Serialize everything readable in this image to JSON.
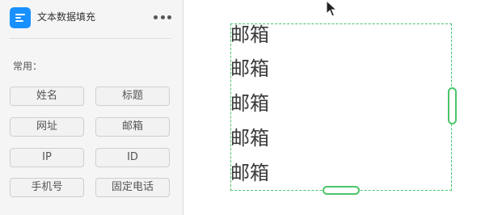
{
  "panel": {
    "title": "文本数据填充",
    "section_label": "常用：",
    "buttons": [
      "姓名",
      "标题",
      "网址",
      "邮箱",
      "IP",
      "ID",
      "手机号",
      "固定电话"
    ]
  },
  "canvas": {
    "lines": [
      "邮箱",
      "邮箱",
      "邮箱",
      "邮箱",
      "邮箱"
    ]
  },
  "colors": {
    "accent": "#1890ff",
    "selection": "#4cc46a",
    "panel_bg": "#f5f5f5"
  },
  "icons": {
    "app": "text-fill-icon",
    "more": "more-horizontal-icon",
    "cursor": "mouse-pointer-icon"
  }
}
